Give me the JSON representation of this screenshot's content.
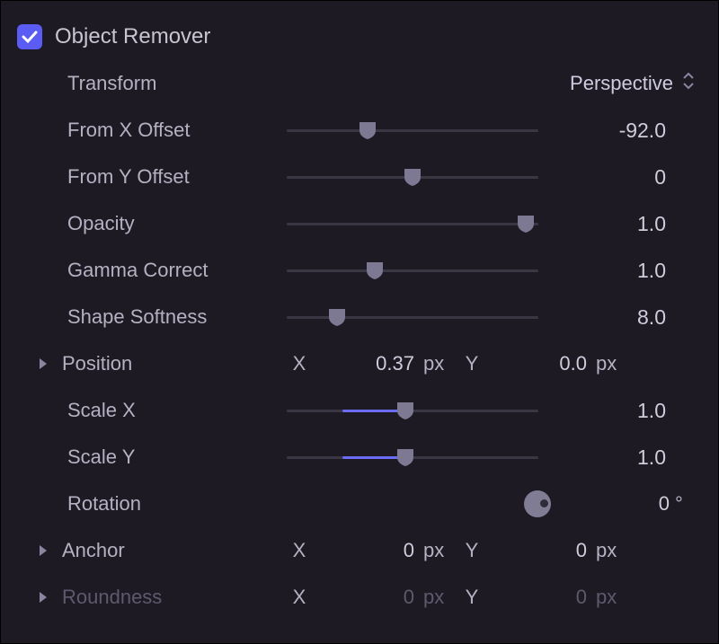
{
  "section": {
    "title": "Object Remover",
    "checked": true
  },
  "transform": {
    "label": "Transform",
    "selected": "Perspective"
  },
  "params": {
    "fromX": {
      "label": "From X Offset",
      "value": "-92.0",
      "pct": 32
    },
    "fromY": {
      "label": "From Y Offset",
      "value": "0",
      "pct": 50
    },
    "opacity": {
      "label": "Opacity",
      "value": "1.0",
      "pct": 95
    },
    "gamma": {
      "label": "Gamma Correct",
      "value": "1.0",
      "pct": 35
    },
    "soft": {
      "label": "Shape Softness",
      "value": "8.0",
      "pct": 20
    },
    "scaleX": {
      "label": "Scale X",
      "value": "1.0",
      "pct": 47,
      "fillStart": 22
    },
    "scaleY": {
      "label": "Scale Y",
      "value": "1.0",
      "pct": 47,
      "fillStart": 22
    }
  },
  "position": {
    "label": "Position",
    "x": "0.37",
    "xUnit": "px",
    "y": "0.0",
    "yUnit": "px"
  },
  "rotation": {
    "label": "Rotation",
    "value": "0",
    "unit": "°"
  },
  "anchor": {
    "label": "Anchor",
    "x": "0",
    "xUnit": "px",
    "y": "0",
    "yUnit": "px"
  },
  "roundness": {
    "label": "Roundness",
    "x": "0",
    "xUnit": "px",
    "y": "0",
    "yUnit": "px"
  },
  "axis": {
    "x": "X",
    "y": "Y"
  }
}
